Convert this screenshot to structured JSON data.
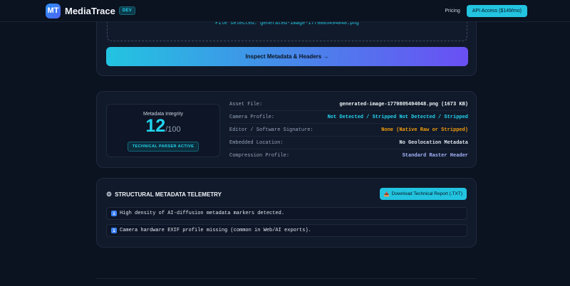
{
  "header": {
    "logo_text": "MT",
    "brand": "MediaTrace",
    "badge": "DEV",
    "nav_pricing": "Pricing",
    "api_button": "API Access ($149/mo)"
  },
  "upload": {
    "file_selected": "File selected: generated-image-1779805494048.png",
    "inspect_button": "Inspect Metadata & Headers →"
  },
  "integrity": {
    "title": "Metadata Integrity",
    "score": "12",
    "max": "/100",
    "badge": "TECHNICAL PARSER ACTIVE"
  },
  "metadata": {
    "rows": [
      {
        "label": "Asset File:",
        "value": "generated-image-1779805494048.png (1673 KB)",
        "color": "#f1f5f9"
      },
      {
        "label": "Camera Profile:",
        "value": "Not Detected / Stripped Not Detected / Stripped",
        "color": "#22d3ee"
      },
      {
        "label": "Editor / Software Signature:",
        "value": "None (Native Raw or Stripped)",
        "color": "#f59e0b"
      },
      {
        "label": "Embedded Location:",
        "value": "No Geolocation Metadata",
        "color": "#e2e8f0"
      },
      {
        "label": "Compression Profile:",
        "value": "Standard Raster Header",
        "color": "#a5b4fc"
      }
    ]
  },
  "telemetry": {
    "title": "STRUCTURAL METADATA TELEMETRY",
    "download_button": "Download Technical Report (.TXT)",
    "items": [
      "High density of AI-diffusion metadata markers detected.",
      "Camera hardware EXIF profile missing (common in Web/AI exports)."
    ],
    "item_icon": "i"
  }
}
